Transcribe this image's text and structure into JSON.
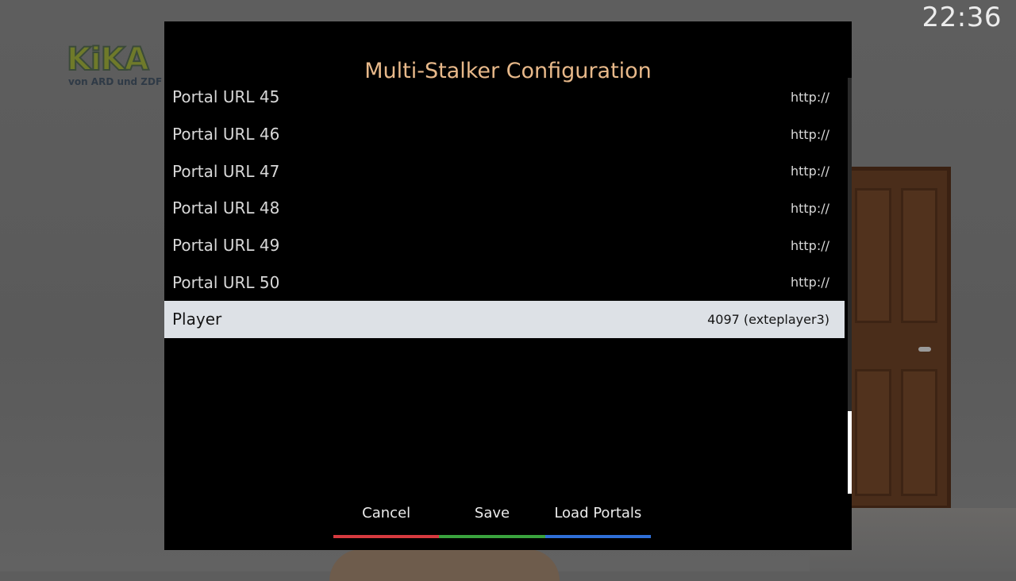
{
  "clock": "22:36",
  "background": {
    "channel_logo_word": "KiKA",
    "channel_logo_sub": "von ARD und ZDF"
  },
  "dialog": {
    "title": "Multi-Stalker Configuration",
    "rows": [
      {
        "label": "Portal URL 45",
        "value": "http://"
      },
      {
        "label": "Portal URL 46",
        "value": "http://"
      },
      {
        "label": "Portal URL 47",
        "value": "http://"
      },
      {
        "label": "Portal URL 48",
        "value": "http://"
      },
      {
        "label": "Portal URL 49",
        "value": "http://"
      },
      {
        "label": "Portal URL 50",
        "value": "http://"
      },
      {
        "label": "Player",
        "value": "4097 (exteplayer3)",
        "selected": true
      }
    ],
    "buttons": [
      {
        "label": "Cancel",
        "color": "#d63a3f"
      },
      {
        "label": "Save",
        "color": "#3aa33e"
      },
      {
        "label": "Load Portals",
        "color": "#2f6fd8"
      }
    ]
  },
  "colors": {
    "title": "#e8b98a",
    "selected_row_bg": "#dde1e6"
  }
}
